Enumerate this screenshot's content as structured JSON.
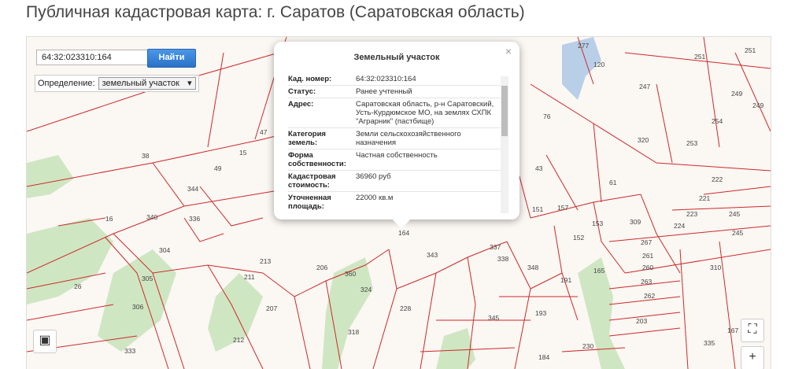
{
  "title": "Публичная кадастровая карта: г. Саратов (Саратовская область)",
  "search": {
    "value": "64:32:023310:164",
    "button": "Найти"
  },
  "definition": {
    "label": "Определение:",
    "selected": "земельный участок"
  },
  "popup": {
    "title": "Земельный участок",
    "close": "×",
    "rows": [
      {
        "k": "Кад. номер:",
        "v": "64:32:023310:164"
      },
      {
        "k": "Статус:",
        "v": "Ранее учтенный"
      },
      {
        "k": "Адрес:",
        "v": "Саратовская область, р-н Саратовский, Усть-Курдюмское МО, на землях СХПК \"Аграрник\" (пастбище)"
      },
      {
        "k": "Категория земель:",
        "v": "Земли сельскохозяйственного назначения"
      },
      {
        "k": "Форма собственности:",
        "v": "Частная собственность"
      },
      {
        "k": "Кадастровая стоимость:",
        "v": "36960 руб"
      },
      {
        "k": "Уточненная площадь:",
        "v": "22000 кв.м"
      }
    ]
  },
  "controls": {
    "zoom_in": "+",
    "fullscreen": "⛶",
    "layers": "▣"
  },
  "parcel_labels": [
    "277",
    "120",
    "251",
    "247",
    "249",
    "249",
    "251",
    "76",
    "320",
    "254",
    "253",
    "43",
    "61",
    "222",
    "221",
    "223",
    "245",
    "224",
    "157",
    "153",
    "151",
    "309",
    "267",
    "261",
    "260",
    "263",
    "262",
    "203",
    "310",
    "335",
    "167",
    "152",
    "191",
    "337",
    "338",
    "348",
    "343",
    "164",
    "345",
    "193",
    "228",
    "184",
    "230",
    "324",
    "318",
    "360",
    "206",
    "213",
    "211",
    "207",
    "212",
    "333",
    "305",
    "306",
    "304",
    "26",
    "336",
    "344",
    "340",
    "16",
    "38",
    "49",
    "47",
    "15",
    "245",
    "165"
  ]
}
